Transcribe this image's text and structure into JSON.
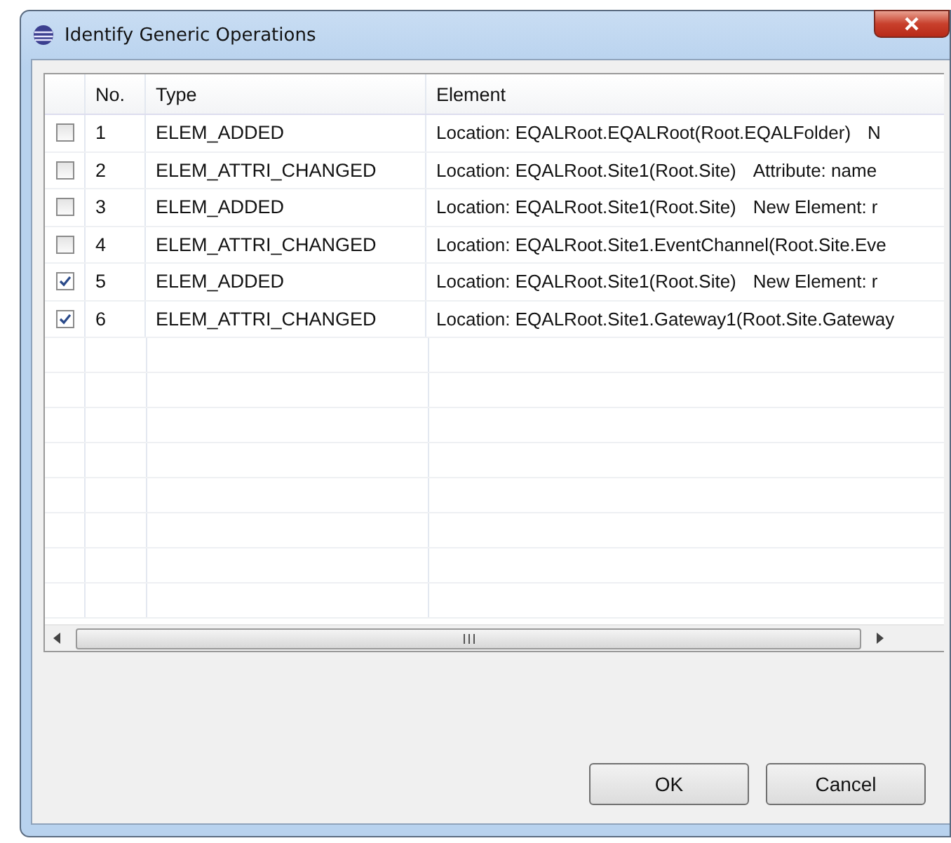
{
  "window": {
    "title": "Identify Generic Operations"
  },
  "table": {
    "columns": [
      "No.",
      "Type",
      "Element"
    ],
    "rows": [
      {
        "checked": false,
        "no": "1",
        "type": "ELEM_ADDED",
        "location": "Location: EQALRoot.EQALRoot(Root.EQALFolder)",
        "detail": "N"
      },
      {
        "checked": false,
        "no": "2",
        "type": "ELEM_ATTRI_CHANGED",
        "location": "Location: EQALRoot.Site1(Root.Site)",
        "detail": "Attribute: name"
      },
      {
        "checked": false,
        "no": "3",
        "type": "ELEM_ADDED",
        "location": "Location: EQALRoot.Site1(Root.Site)",
        "detail": "New Element: r"
      },
      {
        "checked": false,
        "no": "4",
        "type": "ELEM_ATTRI_CHANGED",
        "location": "Location: EQALRoot.Site1.EventChannel(Root.Site.Eve"
      },
      {
        "checked": true,
        "no": "5",
        "type": "ELEM_ADDED",
        "location": "Location: EQALRoot.Site1(Root.Site)",
        "detail": "New Element: r"
      },
      {
        "checked": true,
        "no": "6",
        "type": "ELEM_ATTRI_CHANGED",
        "location": "Location: EQALRoot.Site1.Gateway1(Root.Site.Gateway"
      }
    ]
  },
  "buttons": [
    "OK",
    "Cancel"
  ]
}
